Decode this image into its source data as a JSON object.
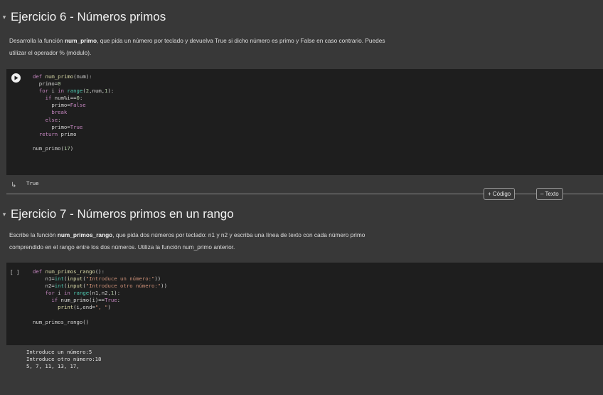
{
  "section6": {
    "title": "Ejercicio 6 - Números primos",
    "desc_parts": [
      "Desarrolla la función ",
      "num_primo",
      ", que pida un número por teclado y devuelva True si dicho número es primo y False en caso contrario. Puedes"
    ],
    "desc_line2": "utilizar el operador % (módulo).",
    "code_lines": [
      "def num_primo(num):",
      "  primo=0",
      "  for i in range(2,num,1):",
      "    if num%i==0:",
      "      primo=False",
      "      break",
      "    else:",
      "      primo=True",
      "  return primo",
      "",
      "num_primo(17)"
    ],
    "output": "True"
  },
  "divider": {
    "add_code": "+ Código",
    "add_text": "– Texto"
  },
  "section7": {
    "title": "Ejercicio 7 - Números primos en un rango",
    "desc_parts": [
      "Escribe la función ",
      "num_primos_rango",
      ", que pida dos números por teclado: n1 y n2 y escriba una línea de texto con cada número primo"
    ],
    "desc_line2": "comprendido en el rango entre los dos números. Utiliza la función num_primo anterior.",
    "bracket": "[ ]",
    "code_lines": [
      "def num_primos_rango():",
      "    n1=int(input(\"Introduce un número:\"))",
      "    n2=int(input(\"Introduce otro número:\"))",
      "    for i in range(n1,n2,1):",
      "      if num_primo(i)==True:",
      "        print(i,end=\", \")",
      "",
      "num_primos_rango()"
    ],
    "output_lines": [
      "Introduce un número:5",
      "Introduce otro número:18",
      "5, 7, 11, 13, 17,"
    ]
  }
}
